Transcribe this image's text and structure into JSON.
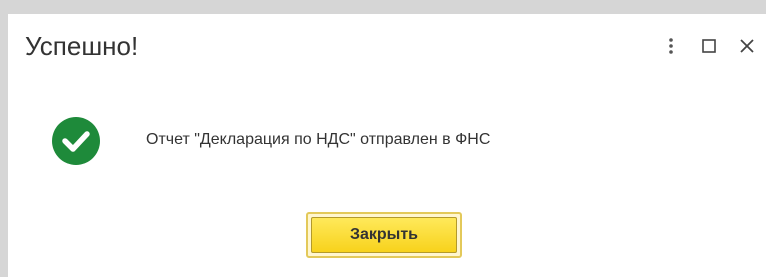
{
  "dialog": {
    "title": "Успешно!",
    "message": "Отчет \"Декларация по НДС\" отправлен в ФНС",
    "close_button_label": "Закрыть"
  },
  "icons": {
    "more": "more-vertical-icon",
    "maximize": "maximize-icon",
    "close": "close-icon",
    "success": "check-circle-icon"
  },
  "colors": {
    "success": "#1e8a3a",
    "button_fill": "#f7d21c",
    "button_border": "#e3c95a"
  }
}
